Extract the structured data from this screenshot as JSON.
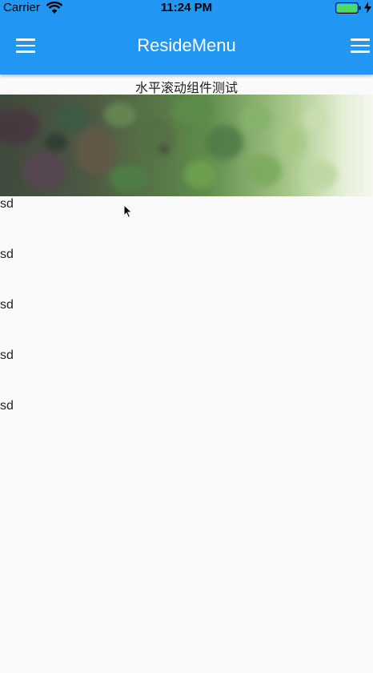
{
  "status_bar": {
    "carrier": "Carrier",
    "time": "11:24 PM",
    "icons": [
      "wifi-icon",
      "battery-icon",
      "charging-bolt-icon"
    ]
  },
  "app_bar": {
    "title": "ResideMenu",
    "left_icon": "menu-icon",
    "right_icon": "menu-icon",
    "background_color": "#2196f3"
  },
  "content": {
    "section_title": "水平滚动组件测试",
    "list_items": [
      "sd",
      "sd",
      "sd",
      "sd",
      "sd"
    ]
  },
  "colors": {
    "page_background": "#fafafa",
    "battery_fill": "#4cd964"
  }
}
